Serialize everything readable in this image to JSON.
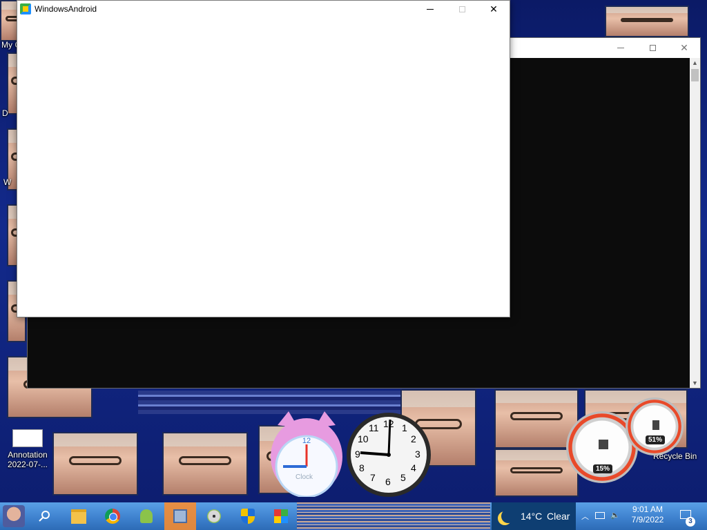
{
  "front_window": {
    "title": "WindowsAndroid",
    "close_glyph": "✕"
  },
  "back_window": {
    "close_glyph": "✕",
    "scroll_up": "▲",
    "scroll_down": "▼"
  },
  "desktop": {
    "label_mycomputer": "My C",
    "label_d": "D",
    "label_w": "W",
    "icon_annotation": {
      "line1": "Annotation",
      "line2": "2022-07-..."
    },
    "icon_recycle": "Recycle Bin"
  },
  "gadgets": {
    "small_clock_text": "Clock",
    "clock_numerals": [
      "12",
      "1",
      "2",
      "3",
      "4",
      "5",
      "6",
      "7",
      "8",
      "9",
      "10",
      "11"
    ],
    "meter_cpu_value": "15%",
    "meter_mem_value": "51%"
  },
  "taskbar": {
    "weather_temp": "14°C",
    "weather_cond": "Clear",
    "time": "9:01 AM",
    "date": "7/9/2022",
    "notif_count": "3",
    "apps": [
      "start-orb",
      "search",
      "file-explorer",
      "chrome",
      "android",
      "network-tool",
      "disc-burner",
      "security-shield",
      "windows-android"
    ]
  },
  "colors": {
    "taskbar": "#3f82cf",
    "weather_bg": "#0e3e72",
    "active_task": "#ff8c28"
  }
}
